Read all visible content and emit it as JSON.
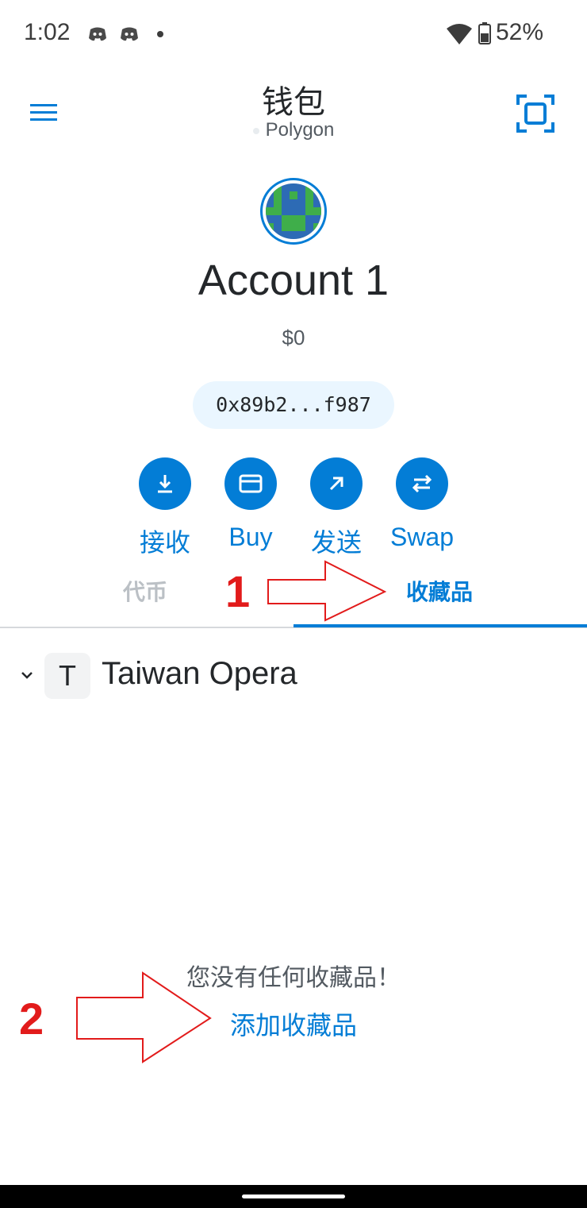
{
  "status_bar": {
    "time": "1:02",
    "battery": "52%"
  },
  "header": {
    "title": "钱包",
    "network": "Polygon"
  },
  "account": {
    "name": "Account 1",
    "balance": "$0",
    "address": "0x89b2...f987"
  },
  "actions": [
    {
      "label": "接收",
      "icon": "download-icon"
    },
    {
      "label": "Buy",
      "icon": "card-icon"
    },
    {
      "label": "发送",
      "icon": "arrow-up-right-icon"
    },
    {
      "label": "Swap",
      "icon": "swap-icon"
    }
  ],
  "tabs": {
    "tokens": "代币",
    "collectibles": "收藏品",
    "active": "collectibles"
  },
  "collection": {
    "badge": "T",
    "name": "Taiwan Opera"
  },
  "empty_state": {
    "message": "您没有任何收藏品！",
    "add_link": "添加收藏品"
  },
  "annotations": {
    "step1": "1",
    "step2": "2"
  },
  "colors": {
    "accent": "#037dd6",
    "annotation_red": "#e21b1b"
  }
}
